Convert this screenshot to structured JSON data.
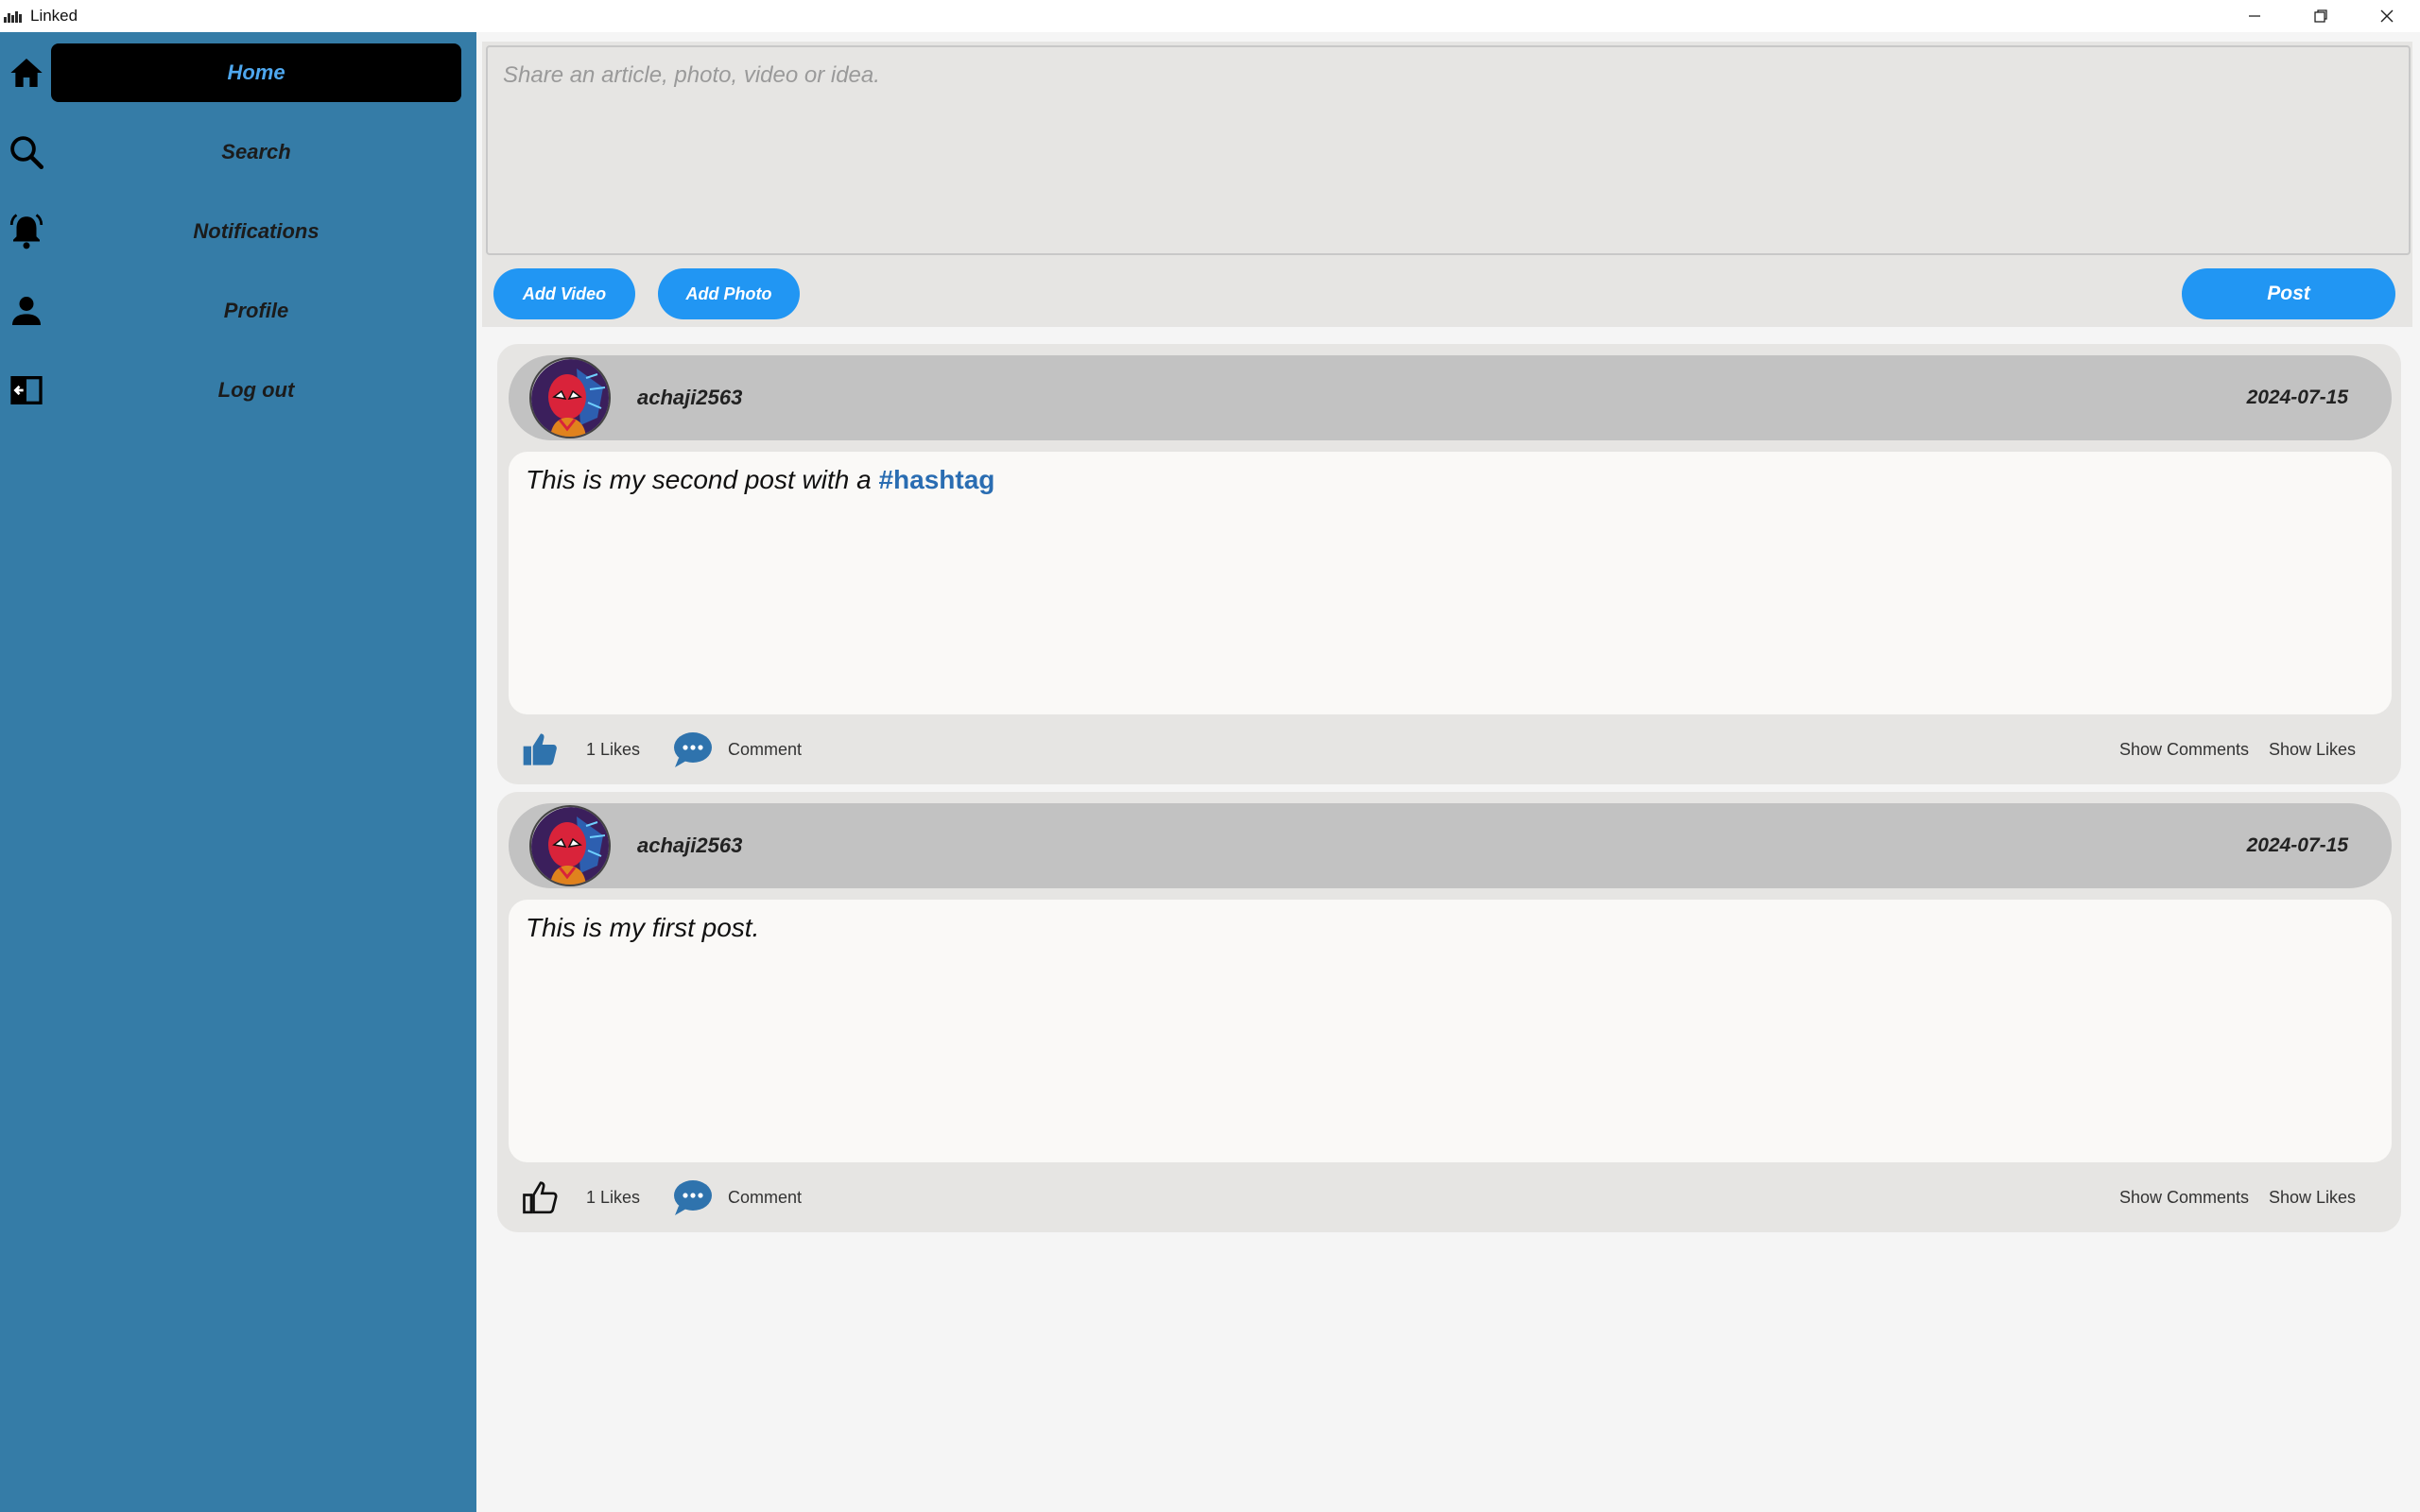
{
  "window": {
    "title": "Linked",
    "controls": [
      "minimize",
      "restore",
      "close"
    ]
  },
  "sidebar": {
    "items": [
      {
        "label": "Home",
        "icon": "home-icon",
        "active": true
      },
      {
        "label": "Search",
        "icon": "search-icon",
        "active": false
      },
      {
        "label": "Notifications",
        "icon": "bell-icon",
        "active": false
      },
      {
        "label": "Profile",
        "icon": "person-icon",
        "active": false
      },
      {
        "label": "Log out",
        "icon": "logout-icon",
        "active": false
      }
    ]
  },
  "composer": {
    "placeholder": "Share an article, photo, video or idea.",
    "value": "",
    "add_video_label": "Add Video",
    "add_photo_label": "Add Photo",
    "post_label": "Post"
  },
  "posts": [
    {
      "username": "achaji2563",
      "date": "2024-07-15",
      "text": "This is my second post with a ",
      "hashtag": "#hashtag",
      "likes": "1 Likes",
      "liked": true,
      "comment_label": "Comment",
      "show_comments_label": "Show Comments",
      "show_likes_label": "Show Likes"
    },
    {
      "username": "achaji2563",
      "date": "2024-07-15",
      "text": "This is my first post.",
      "hashtag": "",
      "likes": "1 Likes",
      "liked": false,
      "comment_label": "Comment",
      "show_comments_label": "Show Comments",
      "show_likes_label": "Show Likes"
    }
  ],
  "colors": {
    "sidebar": "#357ca7",
    "accent": "#2196f3",
    "active_nav_bg": "#000000",
    "active_nav_text": "#4ea7ee",
    "hashtag": "#2a6db2",
    "liked_icon": "#2f73ad"
  }
}
